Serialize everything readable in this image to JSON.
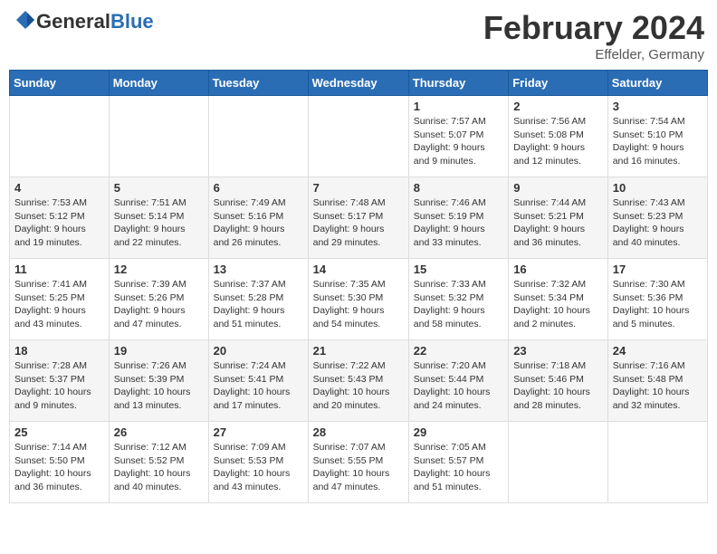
{
  "header": {
    "logo_general": "General",
    "logo_blue": "Blue",
    "month_title": "February 2024",
    "location": "Effelder, Germany"
  },
  "weekdays": [
    "Sunday",
    "Monday",
    "Tuesday",
    "Wednesday",
    "Thursday",
    "Friday",
    "Saturday"
  ],
  "weeks": [
    [
      {
        "day": "",
        "info": ""
      },
      {
        "day": "",
        "info": ""
      },
      {
        "day": "",
        "info": ""
      },
      {
        "day": "",
        "info": ""
      },
      {
        "day": "1",
        "info": "Sunrise: 7:57 AM\nSunset: 5:07 PM\nDaylight: 9 hours\nand 9 minutes."
      },
      {
        "day": "2",
        "info": "Sunrise: 7:56 AM\nSunset: 5:08 PM\nDaylight: 9 hours\nand 12 minutes."
      },
      {
        "day": "3",
        "info": "Sunrise: 7:54 AM\nSunset: 5:10 PM\nDaylight: 9 hours\nand 16 minutes."
      }
    ],
    [
      {
        "day": "4",
        "info": "Sunrise: 7:53 AM\nSunset: 5:12 PM\nDaylight: 9 hours\nand 19 minutes."
      },
      {
        "day": "5",
        "info": "Sunrise: 7:51 AM\nSunset: 5:14 PM\nDaylight: 9 hours\nand 22 minutes."
      },
      {
        "day": "6",
        "info": "Sunrise: 7:49 AM\nSunset: 5:16 PM\nDaylight: 9 hours\nand 26 minutes."
      },
      {
        "day": "7",
        "info": "Sunrise: 7:48 AM\nSunset: 5:17 PM\nDaylight: 9 hours\nand 29 minutes."
      },
      {
        "day": "8",
        "info": "Sunrise: 7:46 AM\nSunset: 5:19 PM\nDaylight: 9 hours\nand 33 minutes."
      },
      {
        "day": "9",
        "info": "Sunrise: 7:44 AM\nSunset: 5:21 PM\nDaylight: 9 hours\nand 36 minutes."
      },
      {
        "day": "10",
        "info": "Sunrise: 7:43 AM\nSunset: 5:23 PM\nDaylight: 9 hours\nand 40 minutes."
      }
    ],
    [
      {
        "day": "11",
        "info": "Sunrise: 7:41 AM\nSunset: 5:25 PM\nDaylight: 9 hours\nand 43 minutes."
      },
      {
        "day": "12",
        "info": "Sunrise: 7:39 AM\nSunset: 5:26 PM\nDaylight: 9 hours\nand 47 minutes."
      },
      {
        "day": "13",
        "info": "Sunrise: 7:37 AM\nSunset: 5:28 PM\nDaylight: 9 hours\nand 51 minutes."
      },
      {
        "day": "14",
        "info": "Sunrise: 7:35 AM\nSunset: 5:30 PM\nDaylight: 9 hours\nand 54 minutes."
      },
      {
        "day": "15",
        "info": "Sunrise: 7:33 AM\nSunset: 5:32 PM\nDaylight: 9 hours\nand 58 minutes."
      },
      {
        "day": "16",
        "info": "Sunrise: 7:32 AM\nSunset: 5:34 PM\nDaylight: 10 hours\nand 2 minutes."
      },
      {
        "day": "17",
        "info": "Sunrise: 7:30 AM\nSunset: 5:36 PM\nDaylight: 10 hours\nand 5 minutes."
      }
    ],
    [
      {
        "day": "18",
        "info": "Sunrise: 7:28 AM\nSunset: 5:37 PM\nDaylight: 10 hours\nand 9 minutes."
      },
      {
        "day": "19",
        "info": "Sunrise: 7:26 AM\nSunset: 5:39 PM\nDaylight: 10 hours\nand 13 minutes."
      },
      {
        "day": "20",
        "info": "Sunrise: 7:24 AM\nSunset: 5:41 PM\nDaylight: 10 hours\nand 17 minutes."
      },
      {
        "day": "21",
        "info": "Sunrise: 7:22 AM\nSunset: 5:43 PM\nDaylight: 10 hours\nand 20 minutes."
      },
      {
        "day": "22",
        "info": "Sunrise: 7:20 AM\nSunset: 5:44 PM\nDaylight: 10 hours\nand 24 minutes."
      },
      {
        "day": "23",
        "info": "Sunrise: 7:18 AM\nSunset: 5:46 PM\nDaylight: 10 hours\nand 28 minutes."
      },
      {
        "day": "24",
        "info": "Sunrise: 7:16 AM\nSunset: 5:48 PM\nDaylight: 10 hours\nand 32 minutes."
      }
    ],
    [
      {
        "day": "25",
        "info": "Sunrise: 7:14 AM\nSunset: 5:50 PM\nDaylight: 10 hours\nand 36 minutes."
      },
      {
        "day": "26",
        "info": "Sunrise: 7:12 AM\nSunset: 5:52 PM\nDaylight: 10 hours\nand 40 minutes."
      },
      {
        "day": "27",
        "info": "Sunrise: 7:09 AM\nSunset: 5:53 PM\nDaylight: 10 hours\nand 43 minutes."
      },
      {
        "day": "28",
        "info": "Sunrise: 7:07 AM\nSunset: 5:55 PM\nDaylight: 10 hours\nand 47 minutes."
      },
      {
        "day": "29",
        "info": "Sunrise: 7:05 AM\nSunset: 5:57 PM\nDaylight: 10 hours\nand 51 minutes."
      },
      {
        "day": "",
        "info": ""
      },
      {
        "day": "",
        "info": ""
      }
    ]
  ]
}
